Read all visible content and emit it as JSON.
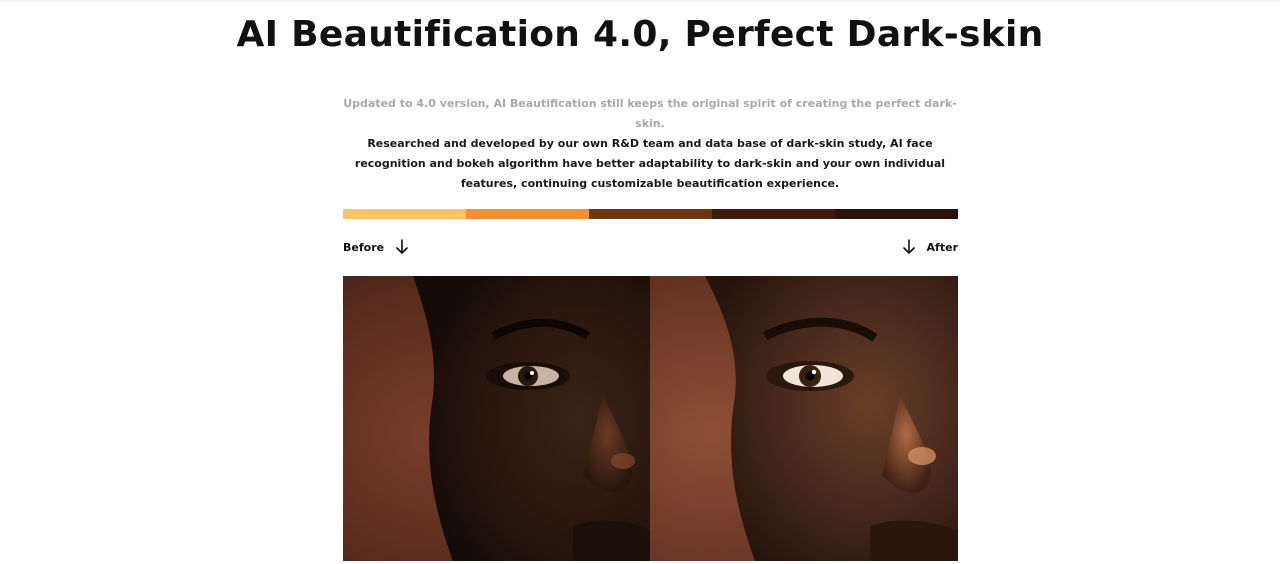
{
  "header": {
    "title": "AI Beautification 4.0, Perfect Dark-skin"
  },
  "description": {
    "line1": "Updated to 4.0 version, AI Beautification still keeps the original spirit of creating the perfect dark-skin.",
    "line2": "Researched and developed by our own R&D team and data base of dark-skin study, AI face recognition and bokeh algorithm have better adaptability to dark-skin and your own individual features, continuing customizable beautification experience."
  },
  "skin_tone_bar": {
    "colors": [
      "#f9c46b",
      "#ed9334",
      "#6b3612",
      "#3d1a0d",
      "#2a120a"
    ]
  },
  "comparison": {
    "before_label": "Before",
    "after_label": "After",
    "before_icon": "arrow-down-icon",
    "after_icon": "arrow-down-icon"
  }
}
